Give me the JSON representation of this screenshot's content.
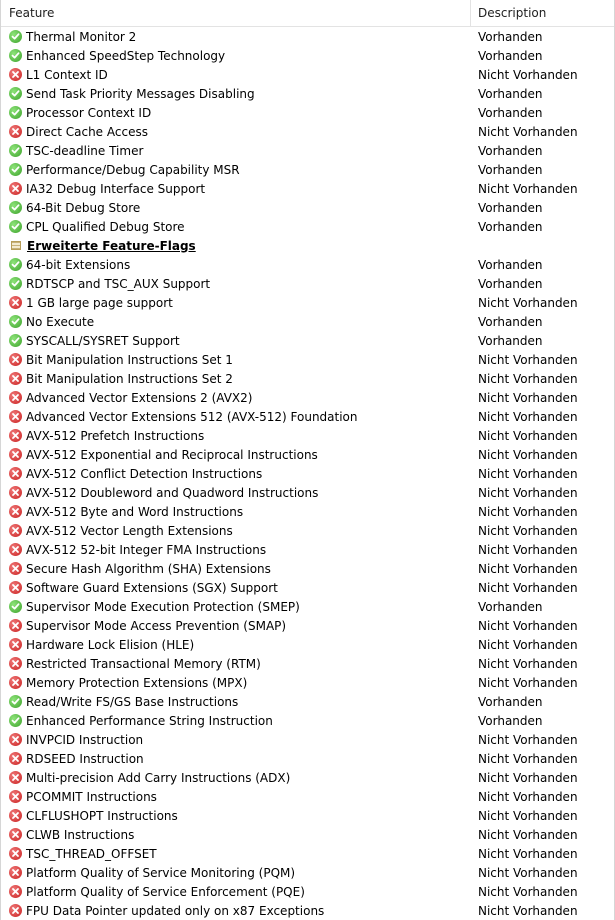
{
  "columns": {
    "feature": "Feature",
    "description": "Description"
  },
  "rows": [
    {
      "type": "item",
      "status": "ok",
      "feature": "Thermal Monitor 2",
      "description": "Vorhanden"
    },
    {
      "type": "item",
      "status": "ok",
      "feature": "Enhanced SpeedStep Technology",
      "description": "Vorhanden"
    },
    {
      "type": "item",
      "status": "no",
      "feature": "L1 Context ID",
      "description": "Nicht Vorhanden"
    },
    {
      "type": "item",
      "status": "ok",
      "feature": "Send Task Priority Messages Disabling",
      "description": "Vorhanden"
    },
    {
      "type": "item",
      "status": "ok",
      "feature": "Processor Context ID",
      "description": "Vorhanden"
    },
    {
      "type": "item",
      "status": "no",
      "feature": "Direct Cache Access",
      "description": "Nicht Vorhanden"
    },
    {
      "type": "item",
      "status": "ok",
      "feature": "TSC-deadline Timer",
      "description": "Vorhanden"
    },
    {
      "type": "item",
      "status": "ok",
      "feature": "Performance/Debug Capability MSR",
      "description": "Vorhanden"
    },
    {
      "type": "item",
      "status": "no",
      "feature": "IA32 Debug Interface Support",
      "description": "Nicht Vorhanden"
    },
    {
      "type": "item",
      "status": "ok",
      "feature": "64-Bit Debug Store",
      "description": "Vorhanden"
    },
    {
      "type": "item",
      "status": "ok",
      "feature": "CPL Qualified Debug Store",
      "description": "Vorhanden"
    },
    {
      "type": "section",
      "feature": "Erweiterte Feature-Flags",
      "description": ""
    },
    {
      "type": "item",
      "status": "ok",
      "feature": "64-bit Extensions",
      "description": "Vorhanden"
    },
    {
      "type": "item",
      "status": "ok",
      "feature": "RDTSCP and TSC_AUX Support",
      "description": "Vorhanden"
    },
    {
      "type": "item",
      "status": "no",
      "feature": "1 GB large page support",
      "description": "Nicht Vorhanden"
    },
    {
      "type": "item",
      "status": "ok",
      "feature": "No Execute",
      "description": "Vorhanden"
    },
    {
      "type": "item",
      "status": "ok",
      "feature": "SYSCALL/SYSRET Support",
      "description": "Vorhanden"
    },
    {
      "type": "item",
      "status": "no",
      "feature": "Bit Manipulation Instructions Set 1",
      "description": "Nicht Vorhanden"
    },
    {
      "type": "item",
      "status": "no",
      "feature": "Bit Manipulation Instructions Set 2",
      "description": "Nicht Vorhanden"
    },
    {
      "type": "item",
      "status": "no",
      "feature": "Advanced Vector Extensions 2 (AVX2)",
      "description": "Nicht Vorhanden"
    },
    {
      "type": "item",
      "status": "no",
      "feature": "Advanced Vector Extensions 512 (AVX-512) Foundation",
      "description": "Nicht Vorhanden"
    },
    {
      "type": "item",
      "status": "no",
      "feature": "AVX-512 Prefetch Instructions",
      "description": "Nicht Vorhanden"
    },
    {
      "type": "item",
      "status": "no",
      "feature": "AVX-512 Exponential and Reciprocal Instructions",
      "description": "Nicht Vorhanden"
    },
    {
      "type": "item",
      "status": "no",
      "feature": "AVX-512 Conflict Detection Instructions",
      "description": "Nicht Vorhanden"
    },
    {
      "type": "item",
      "status": "no",
      "feature": "AVX-512 Doubleword and Quadword Instructions",
      "description": "Nicht Vorhanden"
    },
    {
      "type": "item",
      "status": "no",
      "feature": "AVX-512 Byte and Word Instructions",
      "description": "Nicht Vorhanden"
    },
    {
      "type": "item",
      "status": "no",
      "feature": "AVX-512 Vector Length Extensions",
      "description": "Nicht Vorhanden"
    },
    {
      "type": "item",
      "status": "no",
      "feature": "AVX-512 52-bit Integer FMA Instructions",
      "description": "Nicht Vorhanden"
    },
    {
      "type": "item",
      "status": "no",
      "feature": "Secure Hash Algorithm (SHA) Extensions",
      "description": "Nicht Vorhanden"
    },
    {
      "type": "item",
      "status": "no",
      "feature": "Software Guard Extensions (SGX) Support",
      "description": "Nicht Vorhanden"
    },
    {
      "type": "item",
      "status": "ok",
      "feature": "Supervisor Mode Execution Protection (SMEP)",
      "description": "Vorhanden"
    },
    {
      "type": "item",
      "status": "no",
      "feature": "Supervisor Mode Access Prevention (SMAP)",
      "description": "Nicht Vorhanden"
    },
    {
      "type": "item",
      "status": "no",
      "feature": "Hardware Lock Elision (HLE)",
      "description": "Nicht Vorhanden"
    },
    {
      "type": "item",
      "status": "no",
      "feature": "Restricted Transactional Memory (RTM)",
      "description": "Nicht Vorhanden"
    },
    {
      "type": "item",
      "status": "no",
      "feature": "Memory Protection Extensions (MPX)",
      "description": "Nicht Vorhanden"
    },
    {
      "type": "item",
      "status": "ok",
      "feature": "Read/Write FS/GS Base Instructions",
      "description": "Vorhanden"
    },
    {
      "type": "item",
      "status": "ok",
      "feature": "Enhanced Performance String Instruction",
      "description": "Vorhanden"
    },
    {
      "type": "item",
      "status": "no",
      "feature": "INVPCID Instruction",
      "description": "Nicht Vorhanden"
    },
    {
      "type": "item",
      "status": "no",
      "feature": "RDSEED Instruction",
      "description": "Nicht Vorhanden"
    },
    {
      "type": "item",
      "status": "no",
      "feature": "Multi-precision Add Carry Instructions (ADX)",
      "description": "Nicht Vorhanden"
    },
    {
      "type": "item",
      "status": "no",
      "feature": "PCOMMIT Instructions",
      "description": "Nicht Vorhanden"
    },
    {
      "type": "item",
      "status": "no",
      "feature": "CLFLUSHOPT Instructions",
      "description": "Nicht Vorhanden"
    },
    {
      "type": "item",
      "status": "no",
      "feature": "CLWB Instructions",
      "description": "Nicht Vorhanden"
    },
    {
      "type": "item",
      "status": "no",
      "feature": "TSC_THREAD_OFFSET",
      "description": "Nicht Vorhanden"
    },
    {
      "type": "item",
      "status": "no",
      "feature": "Platform Quality of Service Monitoring (PQM)",
      "description": "Nicht Vorhanden"
    },
    {
      "type": "item",
      "status": "no",
      "feature": "Platform Quality of Service Enforcement (PQE)",
      "description": "Nicht Vorhanden"
    },
    {
      "type": "item",
      "status": "no",
      "feature": "FPU Data Pointer updated only on x87 Exceptions",
      "description": "Nicht Vorhanden"
    }
  ],
  "icons": {
    "ok": "check-circle-icon",
    "no": "x-circle-icon",
    "section": "group-icon"
  },
  "colors": {
    "ok": "#3ca12a",
    "no": "#c92020",
    "header_border": "#e3e3e3"
  }
}
